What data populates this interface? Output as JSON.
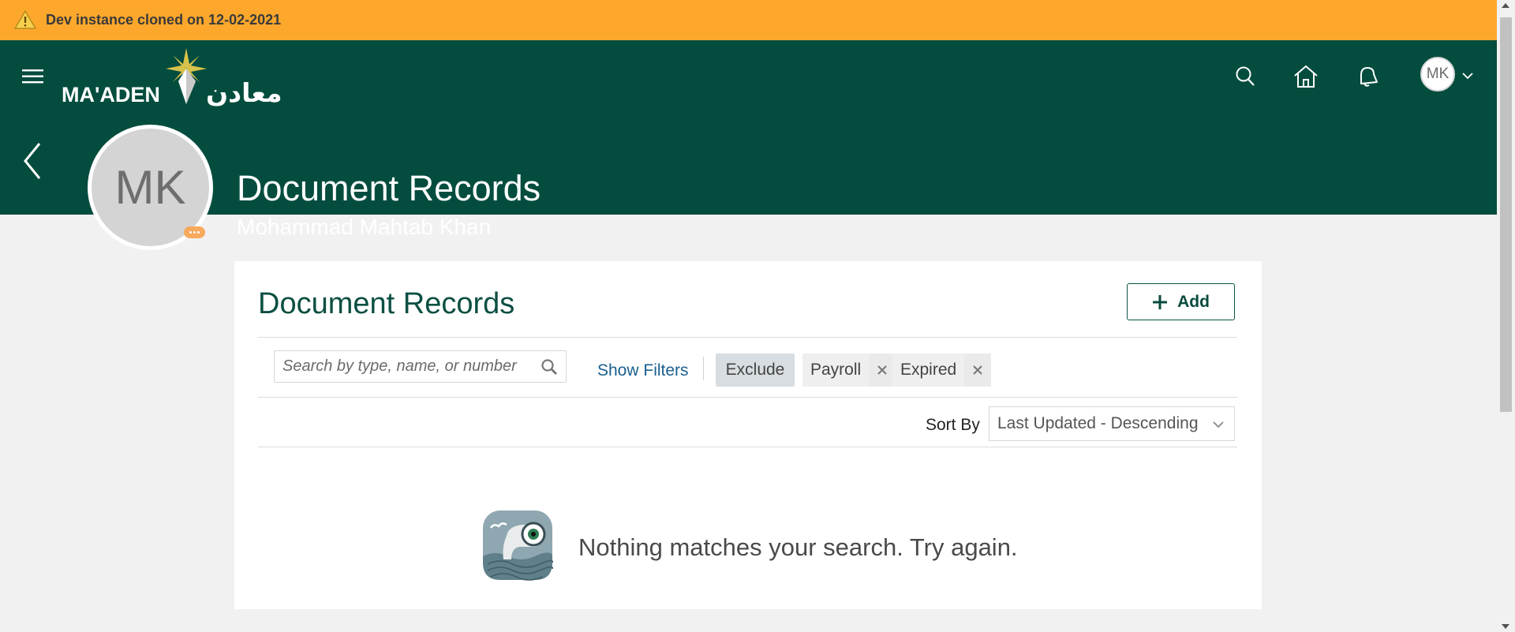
{
  "banner": {
    "text": "Dev instance cloned on 12-02-2021",
    "icon": "warning-icon",
    "color": "#fda82c"
  },
  "header": {
    "brand_en": "MA'ADEN",
    "brand_ar": "معادن",
    "color": "#044d3e",
    "icons": [
      "menu-icon",
      "search-icon",
      "home-icon",
      "notifications-icon"
    ],
    "user_initials": "MK"
  },
  "profile": {
    "initials": "MK",
    "page_title": "Document Records",
    "person_name": "Mohammad Mahtab Khan"
  },
  "card": {
    "title": "Document Records",
    "add_label": "Add",
    "search_placeholder": "Search by type, name, or number",
    "show_filters": "Show Filters",
    "chips": {
      "exclude": "Exclude",
      "payroll": "Payroll",
      "expired": "Expired"
    },
    "sort_label": "Sort By",
    "sort_value": "Last Updated - Descending",
    "empty_message": "Nothing matches your search. Try again."
  }
}
